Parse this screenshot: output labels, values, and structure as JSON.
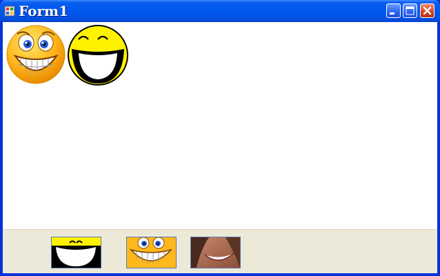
{
  "window": {
    "title": "Form1",
    "icons": {
      "app": "app-icon",
      "minimize": "minimize-icon",
      "maximize": "maximize-icon",
      "close": "close-icon"
    }
  },
  "canvas": {
    "images": [
      {
        "name": "grinning-smiley-image"
      },
      {
        "name": "yellow-grin-smiley-image"
      }
    ]
  },
  "thumbnails": [
    {
      "name": "yellow-grin-thumbnail"
    },
    {
      "name": "grinning-smiley-thumbnail"
    },
    {
      "name": "smiling-face-photo-thumbnail"
    }
  ],
  "colors": {
    "title_bar": "#0058ee",
    "client_bg": "#ffffff",
    "panel_bg": "#ece9d8",
    "close_button": "#d8411c"
  }
}
